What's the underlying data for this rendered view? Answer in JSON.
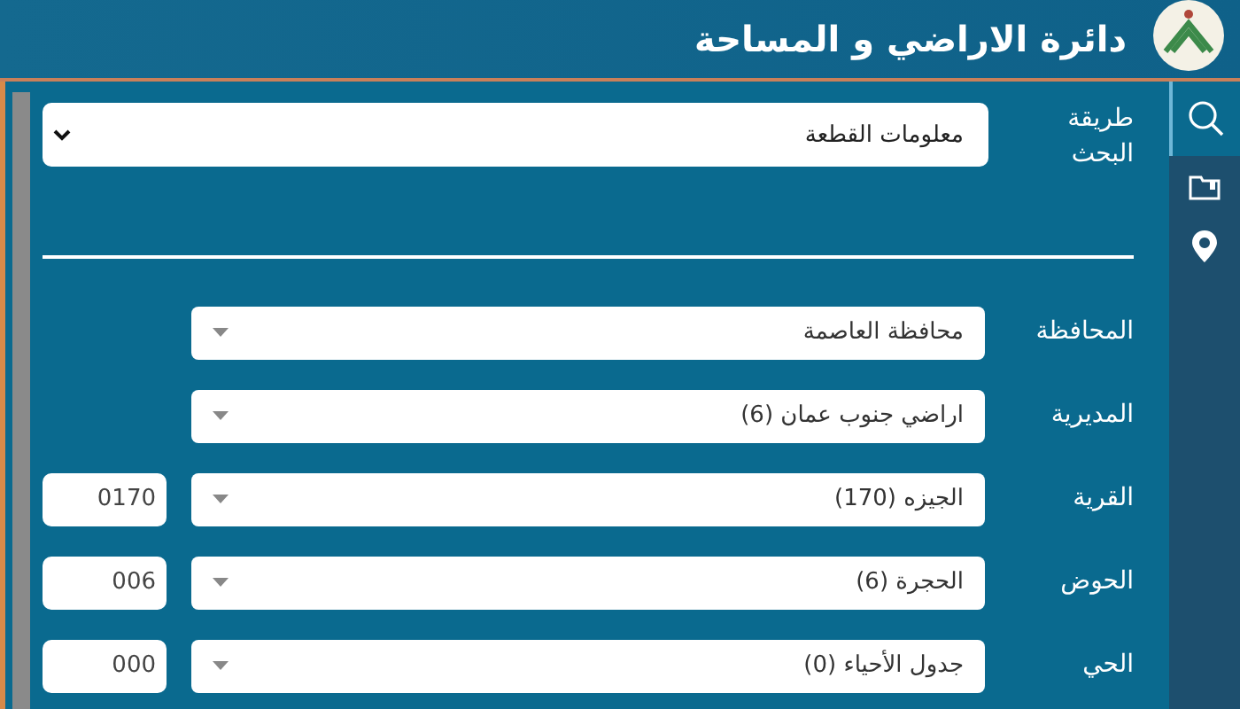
{
  "header": {
    "title": "دائرة الاراضي و المساحة"
  },
  "sidebar": {
    "items": [
      {
        "kind": "search",
        "selected": true
      },
      {
        "kind": "folder",
        "selected": false
      },
      {
        "kind": "pin",
        "selected": false
      }
    ]
  },
  "search_method": {
    "label": "طريقة البحث",
    "value": "معلومات القطعة"
  },
  "fields": [
    {
      "label": "المحافظة",
      "value": "محافظة العاصمة"
    },
    {
      "label": "المديرية",
      "value": "اراضي جنوب عمان (6)"
    },
    {
      "label": "القرية",
      "value": "الجيزه (170)",
      "code": "0170"
    },
    {
      "label": "الحوض",
      "value": "الحجرة (6)",
      "code": "006"
    },
    {
      "label": "الحي",
      "value": "جدول الأحياء (0)",
      "code": "000"
    }
  ]
}
